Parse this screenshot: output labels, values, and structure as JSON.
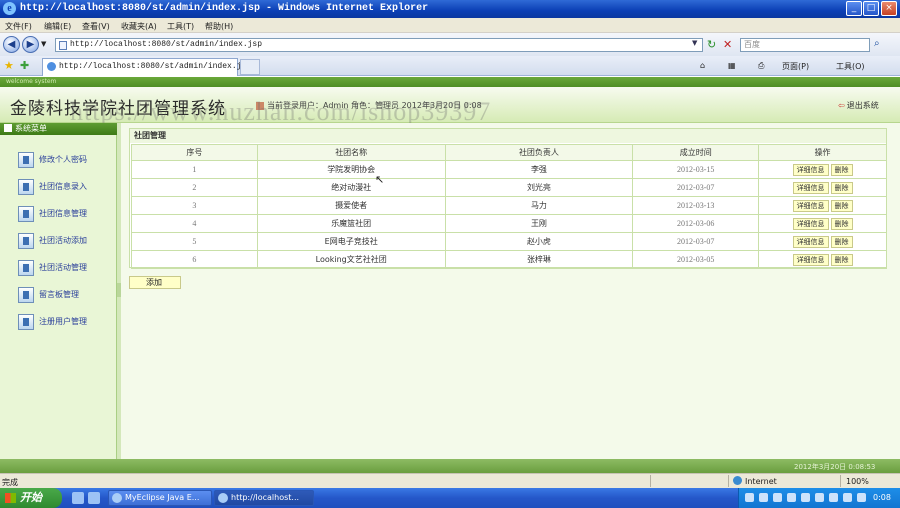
{
  "window": {
    "title": "http://localhost:8080/st/admin/index.jsp - Windows Internet Explorer",
    "min": "_",
    "max": "□",
    "close": "×"
  },
  "menu": [
    "文件(F)",
    "编辑(E)",
    "查看(V)",
    "收藏夹(A)",
    "工具(T)",
    "帮助(H)"
  ],
  "address": {
    "url": "http://localhost:8080/st/admin/index.jsp",
    "search_placeholder": "百度"
  },
  "tab": {
    "title": "http://localhost:8080/st/admin/index.jsp"
  },
  "toolbar": {
    "page": "页面(P)",
    "tools": "工具(O)"
  },
  "header": {
    "strip": "welcome system",
    "title": "金陵科技学院社团管理系统",
    "login_info": "当前登录用户：Admin 角色：管理员     2012年3月20日 0:08",
    "logout": "退出系统",
    "watermark": "https://www.huzhan.com/ishop39397"
  },
  "sidebar": {
    "title": "系统菜单",
    "items": [
      {
        "label": "修改个人密码",
        "icon": "user-key-icon"
      },
      {
        "label": "社团信息录入",
        "icon": "form-icon"
      },
      {
        "label": "社团信息管理",
        "icon": "form-icon"
      },
      {
        "label": "社团活动添加",
        "icon": "form-icon"
      },
      {
        "label": "社团活动管理",
        "icon": "form-icon"
      },
      {
        "label": "留言板管理",
        "icon": "form-icon"
      },
      {
        "label": "注册用户管理",
        "icon": "form-icon"
      }
    ]
  },
  "club_panel": {
    "title": "社团管理",
    "columns": [
      "序号",
      "社团名称",
      "社团负责人",
      "成立时间",
      "操作"
    ],
    "rows": [
      {
        "no": "1",
        "name": "学院发明协会",
        "leader": "李强",
        "date": "2012-03-15"
      },
      {
        "no": "2",
        "name": "绝对动漫社",
        "leader": "刘光亮",
        "date": "2012-03-07"
      },
      {
        "no": "3",
        "name": "摄爱使者",
        "leader": "马力",
        "date": "2012-03-13"
      },
      {
        "no": "4",
        "name": "乐魔篮社团",
        "leader": "王刚",
        "date": "2012-03-06"
      },
      {
        "no": "5",
        "name": "E网电子竞技社",
        "leader": "赵小虎",
        "date": "2012-03-07"
      },
      {
        "no": "6",
        "name": "Looking文艺社社团",
        "leader": "张梓琳",
        "date": "2012-03-05"
      }
    ],
    "detail_label": "详细信息",
    "delete_label": "删除",
    "add_label": "添加"
  },
  "footer": {
    "datetime": "2012年3月20日  0:08:53"
  },
  "status": {
    "left": "完成",
    "zone": "Internet",
    "zoom": "100%"
  },
  "taskbar": {
    "start": "开始",
    "tasks": [
      "MyEclipse Java E...",
      "http://localhost..."
    ],
    "clock": "0:08"
  }
}
